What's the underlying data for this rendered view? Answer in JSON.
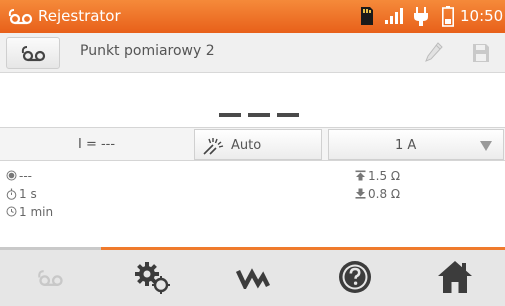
{
  "statusbar": {
    "title": "Rejestrator",
    "time": "10:50",
    "icons": [
      "recorder-icon",
      "sd-card-icon",
      "signal-icon",
      "plug-icon",
      "battery-icon"
    ]
  },
  "pointbar": {
    "point_name": "Punkt pomiarowy 2",
    "icons": [
      "recorder-icon",
      "edit-pencil-icon",
      "save-floppy-icon"
    ]
  },
  "readout": {
    "value": "– – –"
  },
  "params": {
    "current_label": "I = ---",
    "mode_label": "Auto",
    "range_value": "1 A"
  },
  "info": {
    "item1": "---",
    "item2": "1 s",
    "item3": "1 min",
    "upper_limit": "1.5 Ω",
    "lower_limit": "0.8 Ω"
  },
  "nav": {
    "items": [
      "recorder-icon",
      "settings-gears-icon",
      "waveform-icon",
      "help-icon",
      "home-icon"
    ]
  },
  "colors": {
    "accent": "#ef7a2c",
    "nav_background": "#e6e6e6",
    "disabled": "#c8c8c8",
    "icon_dark": "#3c3c3c"
  }
}
